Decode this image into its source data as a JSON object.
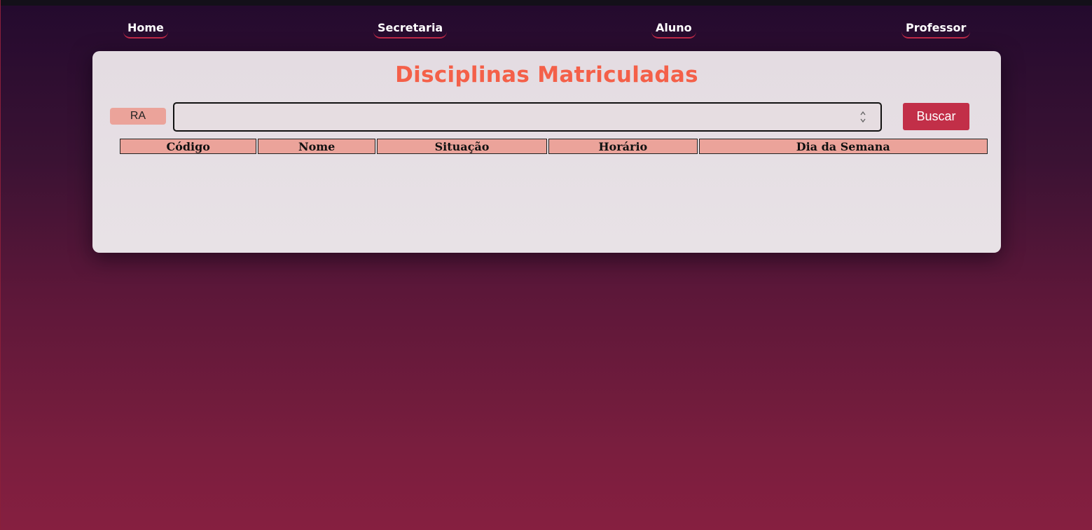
{
  "nav": {
    "home": "Home",
    "secretaria": "Secretaria",
    "aluno": "Aluno",
    "professor": "Professor"
  },
  "card": {
    "title": "Disciplinas Matriculadas",
    "ra_label": "RA",
    "ra_input_value": "",
    "search_button": "Buscar",
    "table": {
      "headers": [
        "Código",
        "Nome",
        "Situação",
        "Horário",
        "Dia da Semana"
      ],
      "rows": []
    }
  },
  "colors": {
    "title": "#f46049",
    "accent": "#c22f48",
    "header_bg": "#eba39a",
    "card_bg": "#e6dfe4"
  },
  "icons": {
    "spinner": "number-spinner-icon"
  }
}
